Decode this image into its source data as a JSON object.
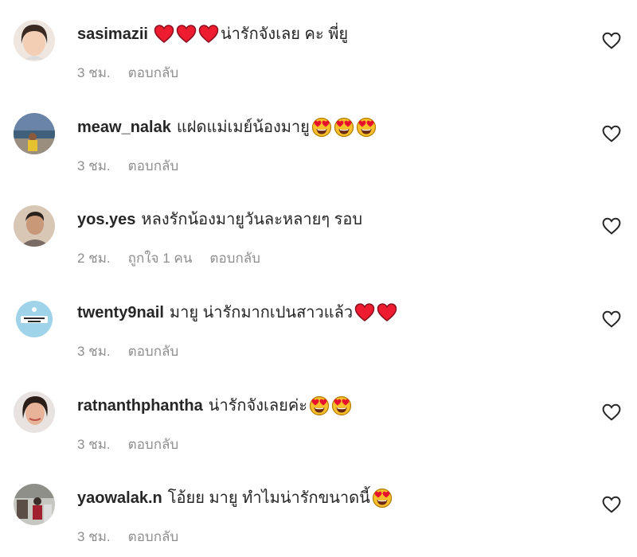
{
  "comments": [
    {
      "username": "sasimazii",
      "emojis_before": [
        "heart",
        "heart",
        "heart"
      ],
      "text": "น่ารักจังเลย คะ พี่ยู",
      "emojis_after": [],
      "time": "3 ชม.",
      "likes": "",
      "reply": "ตอบกลับ",
      "avatar": "woman-smiling"
    },
    {
      "username": "meaw_nalak",
      "emojis_before": [],
      "text": "แฝดแม่เมย์น้องมายู",
      "emojis_after": [
        "heart-eyes",
        "heart-eyes",
        "heart-eyes"
      ],
      "time": "3 ชม.",
      "likes": "",
      "reply": "ตอบกลับ",
      "avatar": "seaside-photo"
    },
    {
      "username": "yos.yes",
      "emojis_before": [],
      "text": "หลงรักน้องมายูวันละหลายๆ รอบ",
      "emojis_after": [],
      "time": "2 ชม.",
      "likes": "ถูกใจ 1 คน",
      "reply": "ตอบกลับ",
      "avatar": "man-portrait"
    },
    {
      "username": "twenty9nail",
      "emojis_before": [],
      "text": "มายู น่ารักมากเปนสาวแล้ว",
      "emojis_after": [
        "heart",
        "heart"
      ],
      "time": "3 ชม.",
      "likes": "",
      "reply": "ตอบกลับ",
      "avatar": "nail-logo"
    },
    {
      "username": "ratnanthphantha",
      "emojis_before": [],
      "text": "น่ารักจังเลยค่ะ",
      "emojis_after": [
        "heart-eyes",
        "heart-eyes"
      ],
      "time": "3 ชม.",
      "likes": "",
      "reply": "ตอบกลับ",
      "avatar": "woman-portrait"
    },
    {
      "username": "yaowalak.n",
      "emojis_before": [],
      "text": "โอ้ยย มายู ทำไมน่ารักขนาดนี้",
      "emojis_after": [
        "heart-eyes"
      ],
      "time": "3 ชม.",
      "likes": "",
      "reply": "ตอบกลับ",
      "avatar": "street-photo"
    }
  ],
  "colors": {
    "text": "#262626",
    "meta": "#8e8e8e",
    "heart": "#ed1c2e",
    "emoji_face": "#f7c02b"
  },
  "like_icon": "heart-outline-icon"
}
